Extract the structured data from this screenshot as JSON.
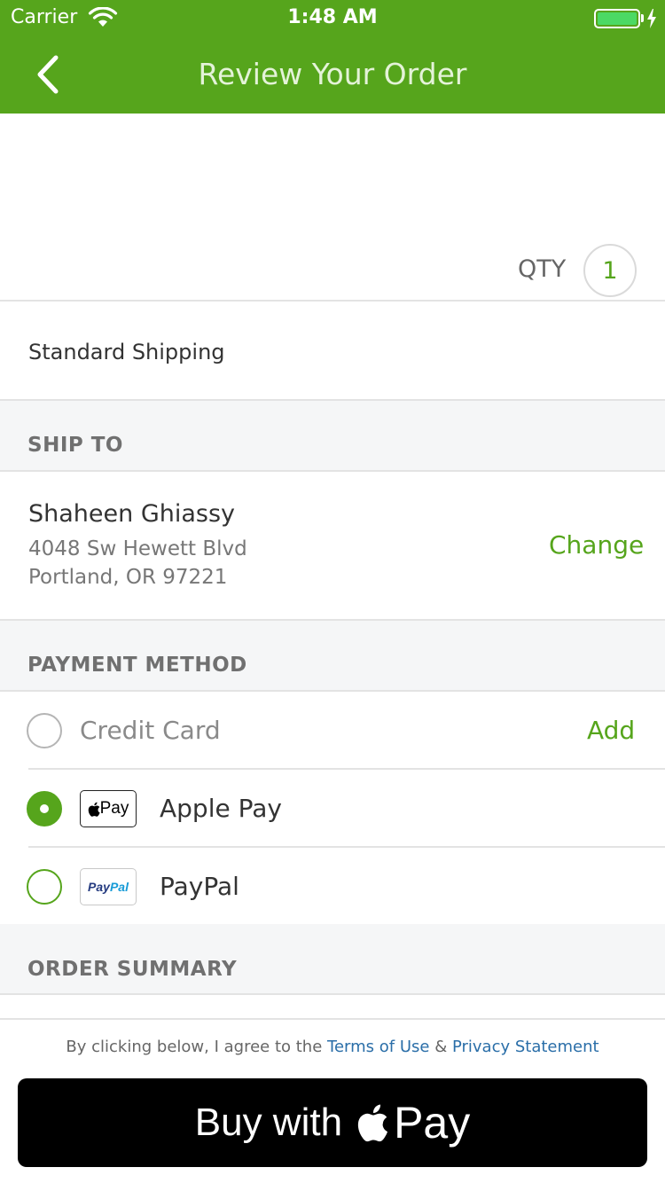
{
  "status_bar": {
    "carrier": "Carrier",
    "time": "1:48 AM",
    "battery_level": 1.0
  },
  "nav": {
    "title": "Review Your Order",
    "back_icon": "chevron-left-icon"
  },
  "product": {
    "qty_label": "QTY",
    "qty_value": "1"
  },
  "shipping": {
    "method": "Standard Shipping"
  },
  "ship_to": {
    "header": "SHIP TO",
    "name": "Shaheen Ghiassy",
    "address_line1": "4048 Sw Hewett Blvd",
    "address_line2": "Portland, OR 97221",
    "change_label": "Change"
  },
  "payment": {
    "header": "PAYMENT METHOD",
    "options": [
      {
        "label": "Credit Card",
        "action": "Add",
        "selected": false
      },
      {
        "label": "Apple Pay",
        "logo": "Pay",
        "selected": true
      },
      {
        "label": "PayPal",
        "logo_part1": "Pay",
        "logo_part2": "Pal",
        "selected": false
      }
    ]
  },
  "summary": {
    "header": "ORDER SUMMARY"
  },
  "footer": {
    "agree_prefix": "By clicking below, I agree to the",
    "terms_link": "Terms of Use",
    "amp": "&",
    "privacy_link": "Privacy Statement",
    "buy_label": "Buy with",
    "buy_pay": "Pay"
  },
  "colors": {
    "brand_green": "#56a51c",
    "link_blue": "#2a6ea8",
    "section_bg": "#f5f6f7"
  }
}
